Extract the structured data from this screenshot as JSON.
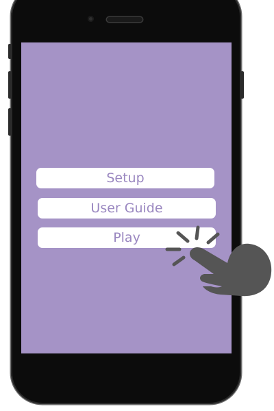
{
  "menu": {
    "setup_label": "Setup",
    "user_guide_label": "User Guide",
    "play_label": "Play"
  },
  "colors": {
    "screen_background": "#a593c6",
    "button_background": "#ffffff",
    "button_text": "#9a87c0",
    "phone_body": "#0c0c0c",
    "hand_icon": "#555555"
  },
  "icons": {
    "tap_gesture": "tap-hand-icon",
    "camera": "camera-icon"
  }
}
